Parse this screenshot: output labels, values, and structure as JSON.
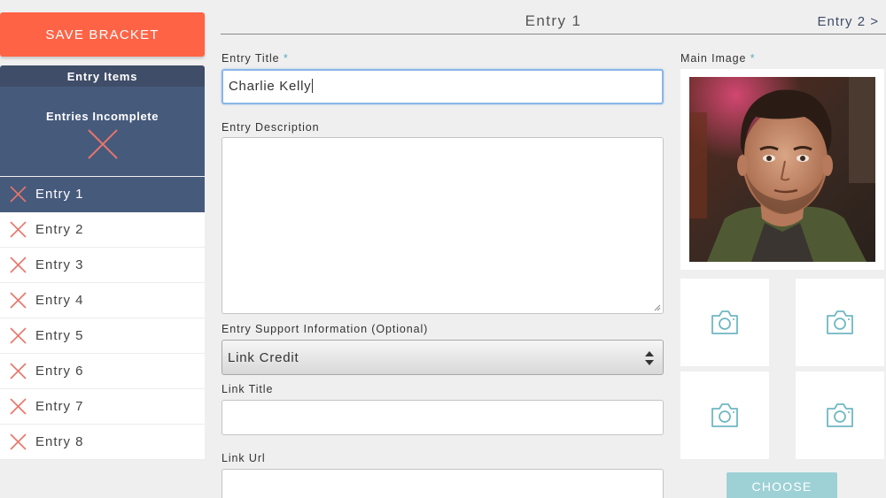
{
  "sidebar": {
    "save_label": "SAVE BRACKET",
    "items_header": "Entry Items",
    "status_text": "Entries Incomplete",
    "entries": [
      {
        "label": "Entry 1",
        "active": true
      },
      {
        "label": "Entry 2",
        "active": false
      },
      {
        "label": "Entry 3",
        "active": false
      },
      {
        "label": "Entry 4",
        "active": false
      },
      {
        "label": "Entry 5",
        "active": false
      },
      {
        "label": "Entry 6",
        "active": false
      },
      {
        "label": "Entry 7",
        "active": false
      },
      {
        "label": "Entry 8",
        "active": false
      }
    ]
  },
  "nav": {
    "current": "Entry 1",
    "next": "Entry 2 >"
  },
  "form": {
    "title_label": "Entry Title",
    "title_value": "Charlie Kelly",
    "required_mark": "*",
    "description_label": "Entry Description",
    "description_value": "",
    "support_label": "Entry Support Information (Optional)",
    "support_selected": "Link Credit",
    "link_title_label": "Link Title",
    "link_title_value": "",
    "link_url_label": "Link Url",
    "link_url_value": ""
  },
  "images": {
    "main_label": "Main Image",
    "choose_label": "CHOOSE",
    "thumb_icon": "camera-icon"
  },
  "colors": {
    "accent": "#ff6346",
    "navy": "#465a7c",
    "teal": "#5aaebb",
    "choose": "#9dd1d6",
    "error_x": "#e8756a"
  }
}
